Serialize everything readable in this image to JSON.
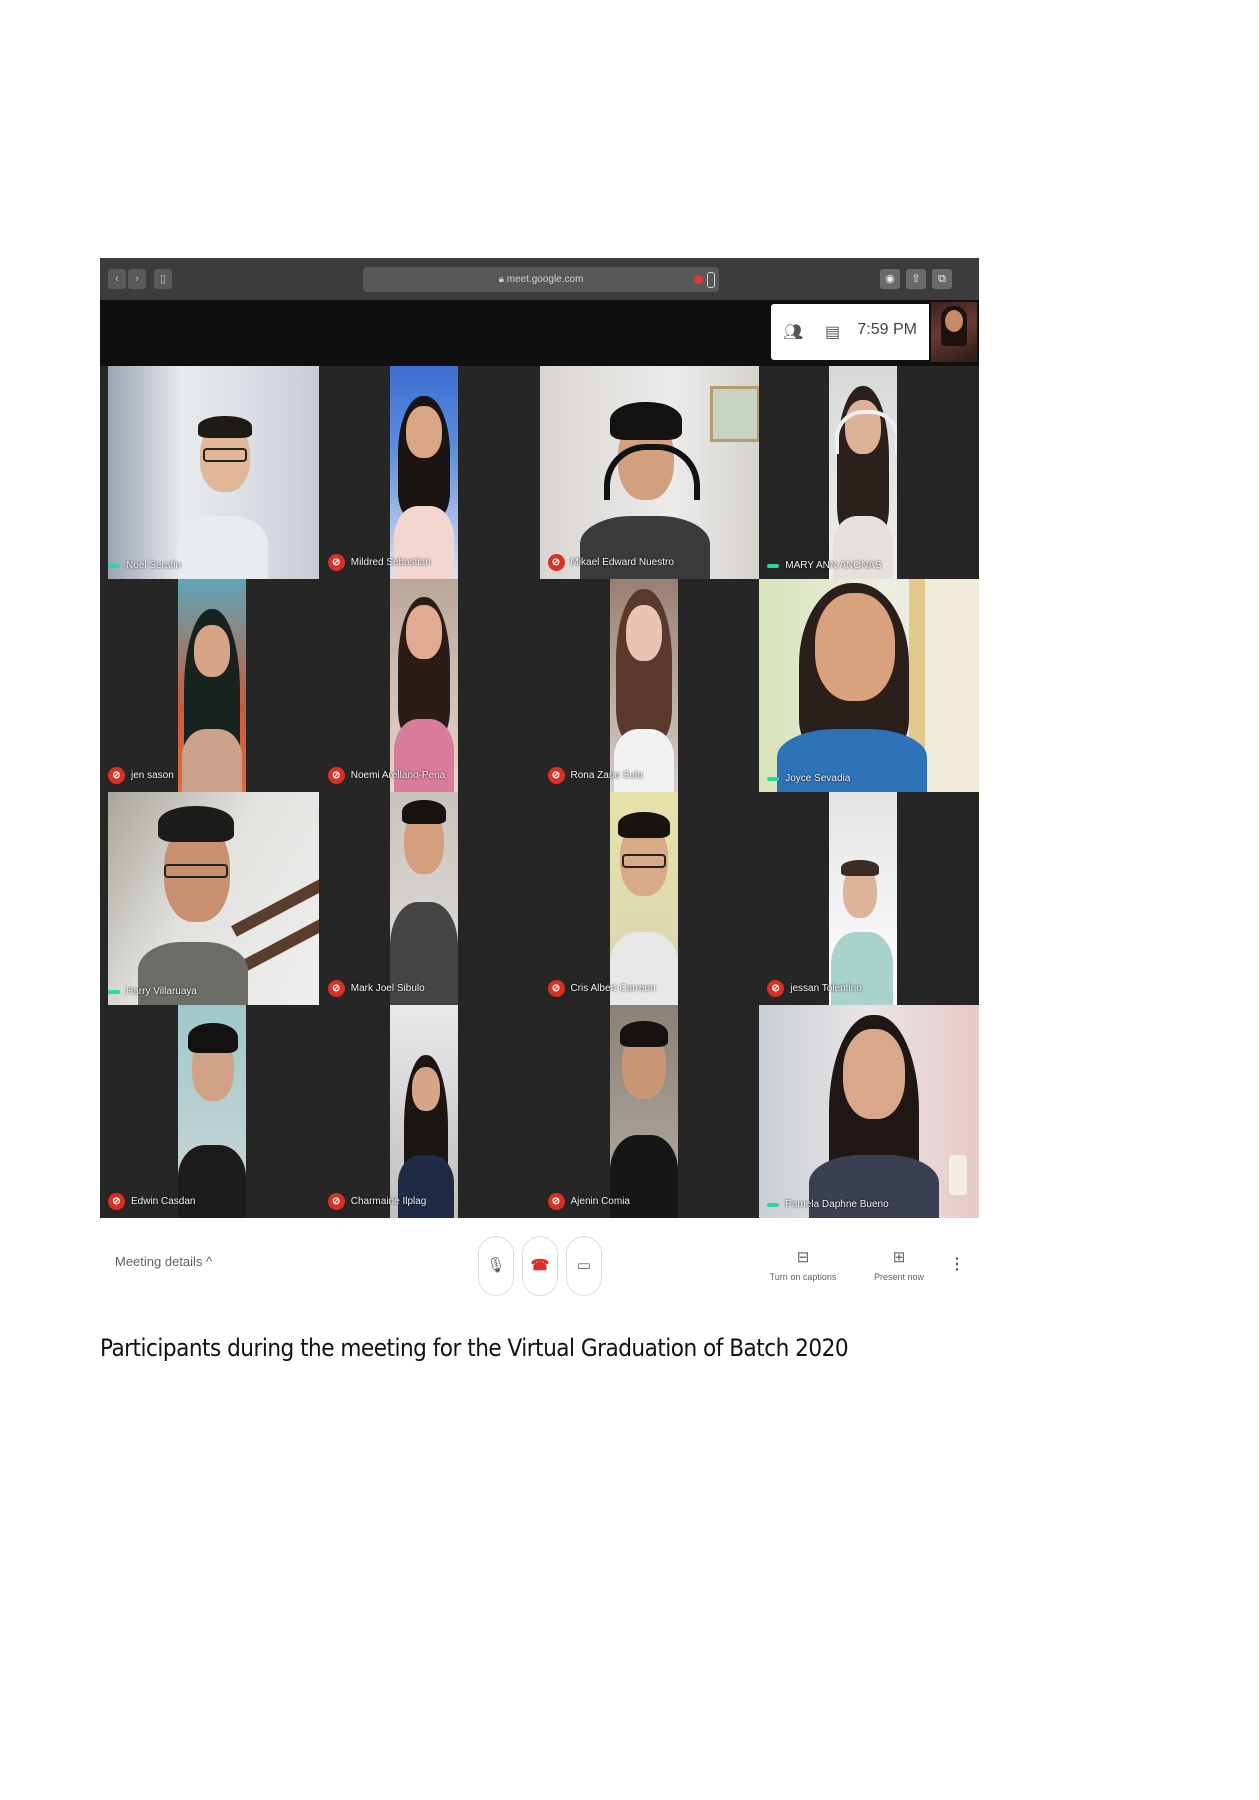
{
  "browser": {
    "url": "meet.google.com"
  },
  "meet_topbar": {
    "time": "7:59 PM",
    "participants_icon": "people-icon",
    "chat_icon": "chat-icon"
  },
  "participants": [
    {
      "name": "Noel Serafin",
      "muted": false
    },
    {
      "name": "Mildred Sebastian",
      "muted": true
    },
    {
      "name": "Mikael Edward Nuestro",
      "muted": true
    },
    {
      "name": "MARY ANN ANONAS",
      "muted": false
    },
    {
      "name": "jen sason",
      "muted": true
    },
    {
      "name": "Noemi Arellano-Pena",
      "muted": true
    },
    {
      "name": "Rona Zarie Sula",
      "muted": true
    },
    {
      "name": "Joyce Sevadia",
      "muted": false
    },
    {
      "name": "Harry Villaruaya",
      "muted": false
    },
    {
      "name": "Mark Joel Sibulo",
      "muted": true
    },
    {
      "name": "Cris Albert Carreon",
      "muted": true
    },
    {
      "name": "jessan Tolentino",
      "muted": true
    },
    {
      "name": "Edwin Casdan",
      "muted": true
    },
    {
      "name": "Charmaine Ilplag",
      "muted": true
    },
    {
      "name": "Ajenin Comia",
      "muted": true
    },
    {
      "name": "Pamela Daphne Bueno",
      "muted": false
    }
  ],
  "controls": {
    "meeting_details": "Meeting details  ^",
    "captions_label": "Turn on captions",
    "present_label": "Present now",
    "more": "⋮"
  },
  "caption": "Participants during the meeting for the Virtual Graduation of Batch 2020",
  "colors": {
    "muted_red": "#d93025",
    "speaking_green": "#2ed6a4",
    "grid_bg": "#262626"
  }
}
